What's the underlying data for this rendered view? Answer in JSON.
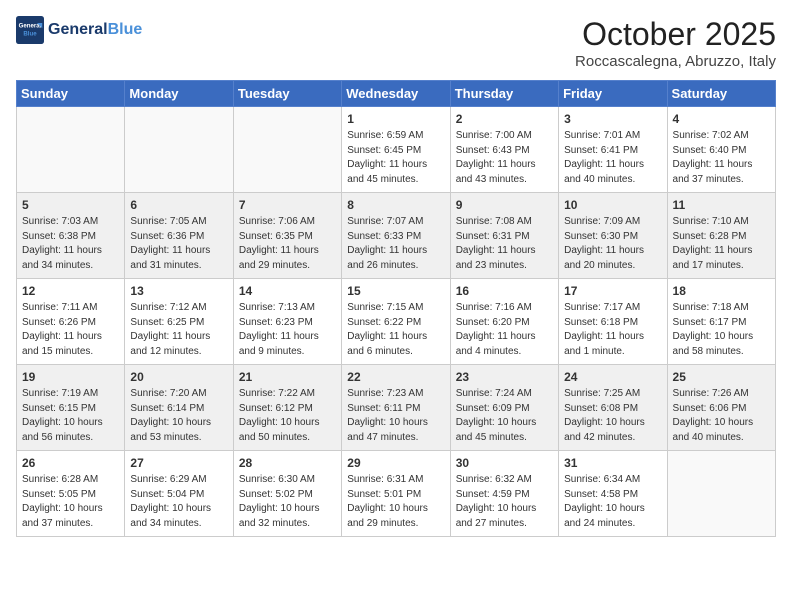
{
  "header": {
    "logo_line1": "General",
    "logo_line2": "Blue",
    "month": "October 2025",
    "location": "Roccascalegna, Abruzzo, Italy"
  },
  "days_of_week": [
    "Sunday",
    "Monday",
    "Tuesday",
    "Wednesday",
    "Thursday",
    "Friday",
    "Saturday"
  ],
  "weeks": [
    [
      {
        "day": "",
        "info": ""
      },
      {
        "day": "",
        "info": ""
      },
      {
        "day": "",
        "info": ""
      },
      {
        "day": "1",
        "info": "Sunrise: 6:59 AM\nSunset: 6:45 PM\nDaylight: 11 hours\nand 45 minutes."
      },
      {
        "day": "2",
        "info": "Sunrise: 7:00 AM\nSunset: 6:43 PM\nDaylight: 11 hours\nand 43 minutes."
      },
      {
        "day": "3",
        "info": "Sunrise: 7:01 AM\nSunset: 6:41 PM\nDaylight: 11 hours\nand 40 minutes."
      },
      {
        "day": "4",
        "info": "Sunrise: 7:02 AM\nSunset: 6:40 PM\nDaylight: 11 hours\nand 37 minutes."
      }
    ],
    [
      {
        "day": "5",
        "info": "Sunrise: 7:03 AM\nSunset: 6:38 PM\nDaylight: 11 hours\nand 34 minutes."
      },
      {
        "day": "6",
        "info": "Sunrise: 7:05 AM\nSunset: 6:36 PM\nDaylight: 11 hours\nand 31 minutes."
      },
      {
        "day": "7",
        "info": "Sunrise: 7:06 AM\nSunset: 6:35 PM\nDaylight: 11 hours\nand 29 minutes."
      },
      {
        "day": "8",
        "info": "Sunrise: 7:07 AM\nSunset: 6:33 PM\nDaylight: 11 hours\nand 26 minutes."
      },
      {
        "day": "9",
        "info": "Sunrise: 7:08 AM\nSunset: 6:31 PM\nDaylight: 11 hours\nand 23 minutes."
      },
      {
        "day": "10",
        "info": "Sunrise: 7:09 AM\nSunset: 6:30 PM\nDaylight: 11 hours\nand 20 minutes."
      },
      {
        "day": "11",
        "info": "Sunrise: 7:10 AM\nSunset: 6:28 PM\nDaylight: 11 hours\nand 17 minutes."
      }
    ],
    [
      {
        "day": "12",
        "info": "Sunrise: 7:11 AM\nSunset: 6:26 PM\nDaylight: 11 hours\nand 15 minutes."
      },
      {
        "day": "13",
        "info": "Sunrise: 7:12 AM\nSunset: 6:25 PM\nDaylight: 11 hours\nand 12 minutes."
      },
      {
        "day": "14",
        "info": "Sunrise: 7:13 AM\nSunset: 6:23 PM\nDaylight: 11 hours\nand 9 minutes."
      },
      {
        "day": "15",
        "info": "Sunrise: 7:15 AM\nSunset: 6:22 PM\nDaylight: 11 hours\nand 6 minutes."
      },
      {
        "day": "16",
        "info": "Sunrise: 7:16 AM\nSunset: 6:20 PM\nDaylight: 11 hours\nand 4 minutes."
      },
      {
        "day": "17",
        "info": "Sunrise: 7:17 AM\nSunset: 6:18 PM\nDaylight: 11 hours\nand 1 minute."
      },
      {
        "day": "18",
        "info": "Sunrise: 7:18 AM\nSunset: 6:17 PM\nDaylight: 10 hours\nand 58 minutes."
      }
    ],
    [
      {
        "day": "19",
        "info": "Sunrise: 7:19 AM\nSunset: 6:15 PM\nDaylight: 10 hours\nand 56 minutes."
      },
      {
        "day": "20",
        "info": "Sunrise: 7:20 AM\nSunset: 6:14 PM\nDaylight: 10 hours\nand 53 minutes."
      },
      {
        "day": "21",
        "info": "Sunrise: 7:22 AM\nSunset: 6:12 PM\nDaylight: 10 hours\nand 50 minutes."
      },
      {
        "day": "22",
        "info": "Sunrise: 7:23 AM\nSunset: 6:11 PM\nDaylight: 10 hours\nand 47 minutes."
      },
      {
        "day": "23",
        "info": "Sunrise: 7:24 AM\nSunset: 6:09 PM\nDaylight: 10 hours\nand 45 minutes."
      },
      {
        "day": "24",
        "info": "Sunrise: 7:25 AM\nSunset: 6:08 PM\nDaylight: 10 hours\nand 42 minutes."
      },
      {
        "day": "25",
        "info": "Sunrise: 7:26 AM\nSunset: 6:06 PM\nDaylight: 10 hours\nand 40 minutes."
      }
    ],
    [
      {
        "day": "26",
        "info": "Sunrise: 6:28 AM\nSunset: 5:05 PM\nDaylight: 10 hours\nand 37 minutes."
      },
      {
        "day": "27",
        "info": "Sunrise: 6:29 AM\nSunset: 5:04 PM\nDaylight: 10 hours\nand 34 minutes."
      },
      {
        "day": "28",
        "info": "Sunrise: 6:30 AM\nSunset: 5:02 PM\nDaylight: 10 hours\nand 32 minutes."
      },
      {
        "day": "29",
        "info": "Sunrise: 6:31 AM\nSunset: 5:01 PM\nDaylight: 10 hours\nand 29 minutes."
      },
      {
        "day": "30",
        "info": "Sunrise: 6:32 AM\nSunset: 4:59 PM\nDaylight: 10 hours\nand 27 minutes."
      },
      {
        "day": "31",
        "info": "Sunrise: 6:34 AM\nSunset: 4:58 PM\nDaylight: 10 hours\nand 24 minutes."
      },
      {
        "day": "",
        "info": ""
      }
    ]
  ]
}
